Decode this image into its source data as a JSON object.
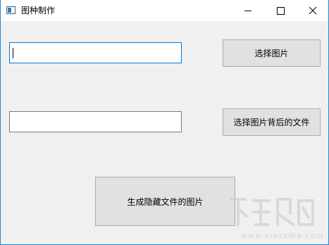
{
  "window": {
    "title": "图种制作",
    "icon": "app-window-icon"
  },
  "caption": {
    "minimize_icon": "minimize-icon",
    "maximize_icon": "maximize-icon",
    "close_icon": "close-icon"
  },
  "form": {
    "image_path": {
      "value": "",
      "placeholder": ""
    },
    "select_image_label": "选择图片",
    "hidden_file_path": {
      "value": "",
      "placeholder": ""
    },
    "select_hidden_file_label": "选择图片背后的文件",
    "generate_label": "生成隐藏文件的图片"
  },
  "watermark": {
    "site": "www.xiazaiba.com",
    "logo": "下载吧"
  },
  "colors": {
    "focus_border": "#0078d7",
    "window_border": "#1e8ad6",
    "client_bg": "#f0f0f0",
    "button_bg": "#e1e1e1"
  }
}
